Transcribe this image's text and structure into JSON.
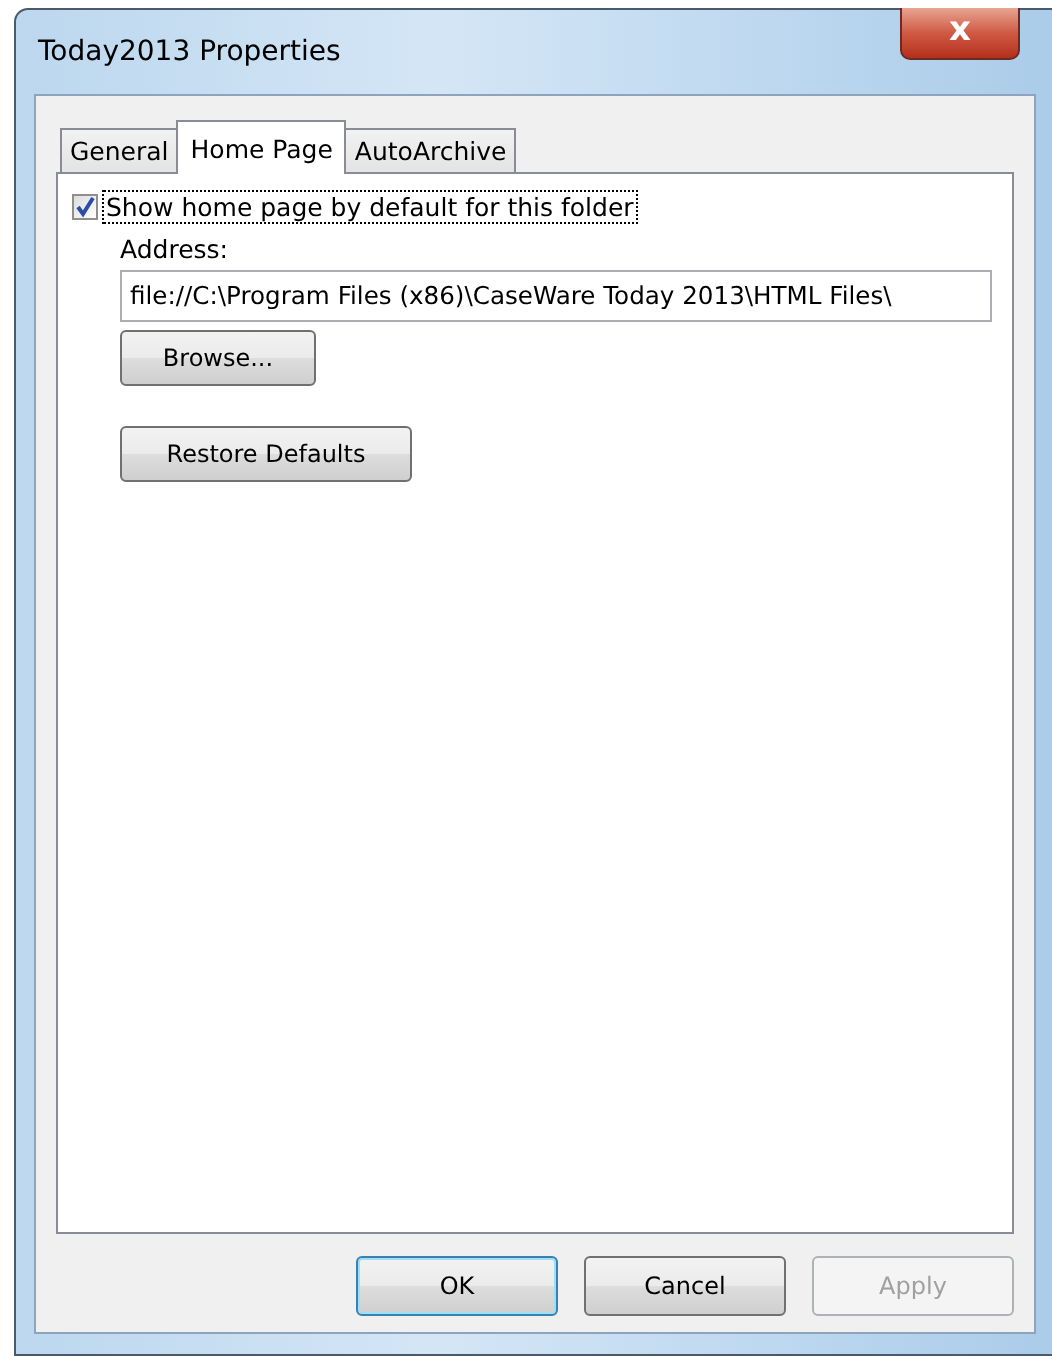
{
  "window": {
    "title": "Today2013 Properties",
    "close_glyph": "x"
  },
  "tabs": [
    {
      "label": "General",
      "selected": false
    },
    {
      "label": "Home Page",
      "selected": true
    },
    {
      "label": "AutoArchive",
      "selected": false
    }
  ],
  "checkbox": {
    "label": "Show home page by default for this folder",
    "checked": true
  },
  "address": {
    "label": "Address:",
    "value": "file://C:\\Program Files (x86)\\CaseWare Today 2013\\HTML Files\\"
  },
  "panel_buttons": [
    {
      "label": "Browse...",
      "kind": "browse"
    },
    {
      "label": "Restore Defaults",
      "kind": "restore"
    }
  ],
  "buttons": [
    {
      "label": "OK",
      "default": true,
      "disabled": false
    },
    {
      "label": "Cancel",
      "default": false,
      "disabled": false
    },
    {
      "label": "Apply",
      "default": false,
      "disabled": true
    }
  ]
}
